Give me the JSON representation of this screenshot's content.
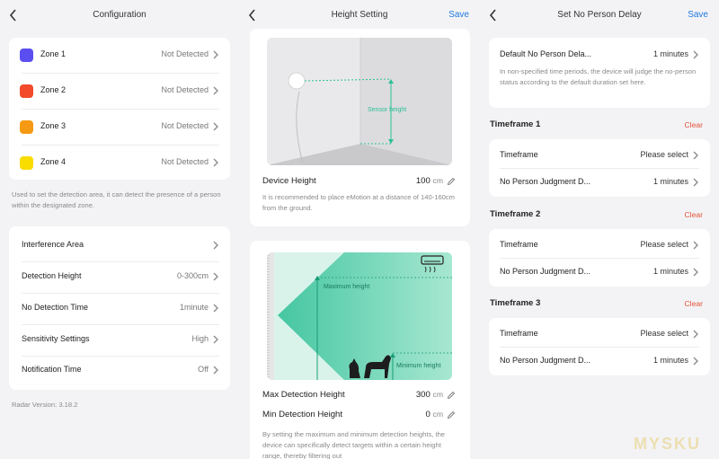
{
  "config": {
    "title": "Configuration",
    "zones": [
      {
        "label": "Zone 1",
        "status": "Not Detected",
        "color": "#5b4ef0"
      },
      {
        "label": "Zone 2",
        "status": "Not Detected",
        "color": "#f24a2a"
      },
      {
        "label": "Zone 3",
        "status": "Not Detected",
        "color": "#f59a12"
      },
      {
        "label": "Zone 4",
        "status": "Not Detected",
        "color": "#f9dc00"
      }
    ],
    "zones_note": "Used to set the detection area, it can detect the presence of a person within the designated zone.",
    "settings": [
      {
        "label": "Interference Area",
        "value": ""
      },
      {
        "label": "Detection Height",
        "value": "0-300cm"
      },
      {
        "label": "No Detection Time",
        "value": "1minute"
      },
      {
        "label": "Sensitivity Settings",
        "value": "High"
      },
      {
        "label": "Notification Time",
        "value": "Off"
      }
    ],
    "version": "Radar Version: 3.18.2"
  },
  "height": {
    "title": "Height Setting",
    "save": "Save",
    "sensor_label": "Sensor height",
    "device_height_label": "Device Height",
    "device_height_value": "100",
    "unit": "cm",
    "device_note": "It is recommended to place eMotion at a distance of 140-160cm from the ground.",
    "max_label_fig": "Maximum height",
    "min_label_fig": "Minimum height",
    "max_label": "Max Detection Height",
    "max_value": "300",
    "min_label": "Min Detection Height",
    "min_value": "0",
    "range_note": "By setting the maximum and minimum detection heights, the device can specifically detect targets within a certain height range, thereby filtering out"
  },
  "delay": {
    "title": "Set No Person Delay",
    "save": "Save",
    "default_label": "Default No Person Dela...",
    "default_value": "1 minutes",
    "default_note": "In non-specified time periods, the device will judge the no-person status according to the default duration set here.",
    "clear": "Clear",
    "timeframes": [
      {
        "title": "Timeframe 1",
        "tf_label": "Timeframe",
        "tf_value": "Please select",
        "judg_label": "No Person Judgment D...",
        "judg_value": "1 minutes"
      },
      {
        "title": "Timeframe 2",
        "tf_label": "Timeframe",
        "tf_value": "Please select",
        "judg_label": "No Person Judgment D...",
        "judg_value": "1 minutes"
      },
      {
        "title": "Timeframe 3",
        "tf_label": "Timeframe",
        "tf_value": "Please select",
        "judg_label": "No Person Judgment D...",
        "judg_value": "1 minutes"
      }
    ]
  },
  "watermark": "MYSKU"
}
